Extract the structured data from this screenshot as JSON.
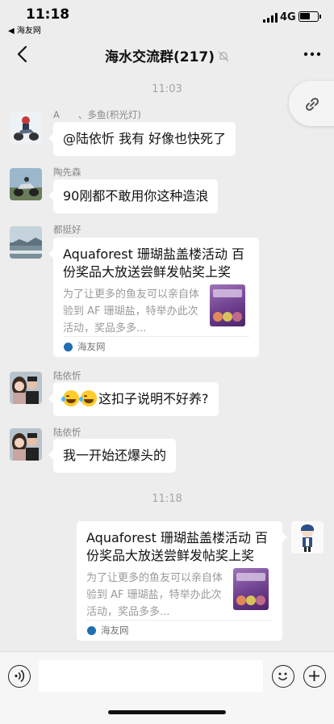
{
  "status_bar": {
    "time": "11:18",
    "back_app": "◀ 海友网",
    "network": "4G",
    "battery_level": 0.6,
    "signal_bars": 4
  },
  "nav": {
    "title": "海水交流群(217)",
    "back_icon": "chevron-left-icon",
    "more_icon": "more-dots-icon",
    "muted_icon": "bell-off-icon"
  },
  "timestamps": [
    "11:03",
    "11:18"
  ],
  "messages": [
    {
      "sender": "A　　、多鱼(积光灯)",
      "text": "@陆依忻  我有  好像也快死了"
    },
    {
      "sender": "陶先森",
      "text": "90刚都不敢用你这种造浪"
    },
    {
      "sender": "都挺好",
      "card": {
        "title": "Aquaforest 珊瑚盐盖楼活动 百份奖品大放送尝鲜发帖奖上奖",
        "desc": "为了让更多的鱼友可以亲自体验到 AF 珊瑚盐，特举办此次活动，奖品多多...",
        "source": "海友网"
      }
    },
    {
      "sender": "陆依忻",
      "text": "这扣子说明不好养?"
    },
    {
      "sender": "陆依忻",
      "text": "我一开始还爆头的"
    },
    {
      "sender": "",
      "card": {
        "title": "Aquaforest 珊瑚盐盖楼活动 百份奖品大放送尝鲜发帖奖上奖",
        "desc": "为了让更多的鱼友可以亲自体验到 AF 珊瑚盐，特举办此次活动，奖品多多...",
        "source": "海友网"
      }
    }
  ],
  "floating_button": {
    "icon": "link-icon"
  },
  "input_bar": {
    "value": "",
    "voice_icon": "voice-icon",
    "emoji_icon": "emoji-icon",
    "plus_icon": "plus-icon"
  }
}
